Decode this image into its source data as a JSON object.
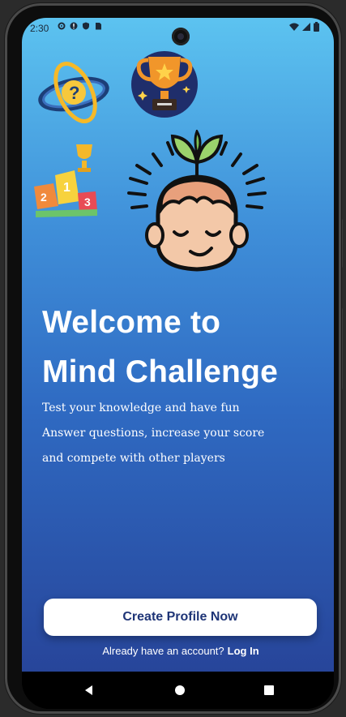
{
  "status_bar": {
    "time": "2:30",
    "left_icons": [
      "gear-icon",
      "warning-icon",
      "shield-icon",
      "sim-icon"
    ],
    "right_icons": [
      "wifi-icon",
      "signal-icon",
      "battery-icon"
    ]
  },
  "illustrations": [
    "question-orbit-icon",
    "trophy-badge-icon",
    "podium-icon",
    "mind-plant-head-icon"
  ],
  "welcome": {
    "title_line1": "Welcome to",
    "title_line2": "Mind Challenge",
    "line1": "Test your knowledge and have fun",
    "line2": "Answer questions, increase your score",
    "line3": "and compete with other players"
  },
  "actions": {
    "create_profile_label": "Create Profile Now",
    "login_prompt": "Already have an account?",
    "login_link": "Log In"
  },
  "nav_bar": [
    "back-icon",
    "home-icon",
    "recent-apps-icon"
  ],
  "colors": {
    "gradient_top": "#5cc3f0",
    "gradient_bottom": "#27459a",
    "button_text": "#1f3577",
    "button_bg": "#ffffff"
  }
}
